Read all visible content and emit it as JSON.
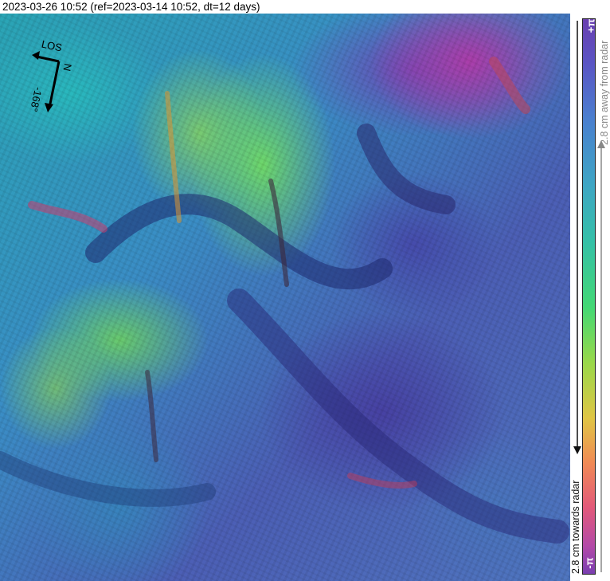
{
  "title": "2023-03-26 10:52 (ref=2023-03-14 10:52, dt=12 days)",
  "compass": {
    "los_label": "LOS",
    "north_label": "N",
    "heading_label": "-168°"
  },
  "colorbar": {
    "top_label": "+π",
    "bottom_label": "-π",
    "away_label": "2.8 cm away from radar",
    "towards_label": "2.8 cm towards radar"
  },
  "map": {
    "description_icon": "interferogram-raster"
  }
}
